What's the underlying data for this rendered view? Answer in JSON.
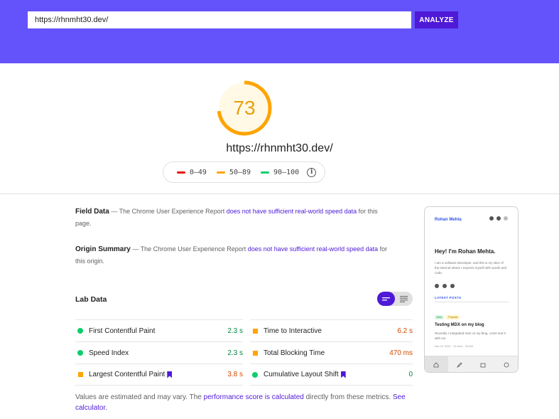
{
  "header": {
    "url_value": "https://rhnmht30.dev/",
    "analyze_label": "ANALYZE"
  },
  "summary": {
    "score": "73",
    "score_fraction": 0.73,
    "url": "https://rhnmht30.dev/",
    "legend": [
      {
        "label": "0–49",
        "color": "#eb0f00"
      },
      {
        "label": "50–89",
        "color": "#ffa400"
      },
      {
        "label": "90–100",
        "color": "#0cce6b"
      }
    ],
    "info_glyph": "i"
  },
  "field_data": {
    "title": "Field Data",
    "prefix": " — The Chrome User Experience Report ",
    "link": "does not have sufficient real-world speed data",
    "suffix": " for this page."
  },
  "origin_summary": {
    "title": "Origin Summary",
    "prefix": " — The Chrome User Experience Report ",
    "link": "does not have sufficient real-world speed data",
    "suffix": " for this origin."
  },
  "lab": {
    "title": "Lab Data",
    "metrics": [
      {
        "label": "First Contentful Paint",
        "value": "2.3 s",
        "status": "good",
        "color": "#018642",
        "bookmark": false
      },
      {
        "label": "Time to Interactive",
        "value": "6.2 s",
        "status": "average",
        "color": "#d04900",
        "bookmark": false
      },
      {
        "label": "Speed Index",
        "value": "2.3 s",
        "status": "good",
        "color": "#018642",
        "bookmark": false
      },
      {
        "label": "Total Blocking Time",
        "value": "470 ms",
        "status": "average",
        "color": "#d04900",
        "bookmark": false
      },
      {
        "label": "Largest Contentful Paint",
        "value": "3.8 s",
        "status": "average",
        "color": "#d04900",
        "bookmark": true
      },
      {
        "label": "Cumulative Layout Shift",
        "value": "0",
        "status": "good",
        "color": "#018642",
        "bookmark": true
      }
    ]
  },
  "footnote": {
    "prefix": "Values are estimated and may vary. The ",
    "link1": "performance score is calculated",
    "middle": " directly from these metrics. ",
    "link2": "See calculator."
  },
  "preview": {
    "site_name": "Rohan Mehta",
    "hero": "Hey! I'm Rohan Mehta.",
    "desc": "I am a software developer, and this is my slice of the internet where I express myself with words and code.",
    "latest": "LATEST POSTS",
    "tag1": "blue",
    "tag2": "Popular",
    "post_title": "Testing MDX on my blog",
    "post_desc": "Recently I integrated mdx on my blog, come test it with me",
    "meta": "Nov 19, 2020 · 13 mins · 99,000"
  },
  "colors": {
    "header_bg": "#6452fa",
    "accent": "#4f19d8",
    "average": "#ffa400",
    "good": "#0cce6b"
  }
}
